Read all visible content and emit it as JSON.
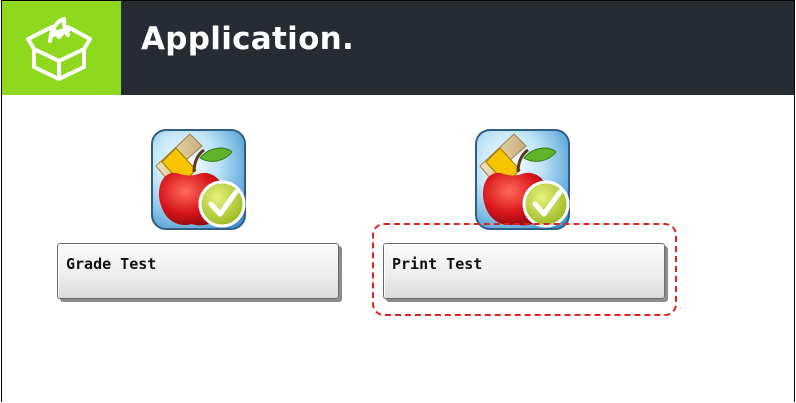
{
  "header": {
    "title": "Application.",
    "icon": "open-box-icon",
    "accent_color": "#8ed81e",
    "background_color": "#262b34"
  },
  "apps": [
    {
      "label": "Grade Test",
      "icon": "apple-ruler-check-icon"
    },
    {
      "label": "Print Test",
      "icon": "apple-ruler-check-icon"
    }
  ],
  "highlight": {
    "target": "Print Test",
    "color": "#e2231a"
  }
}
